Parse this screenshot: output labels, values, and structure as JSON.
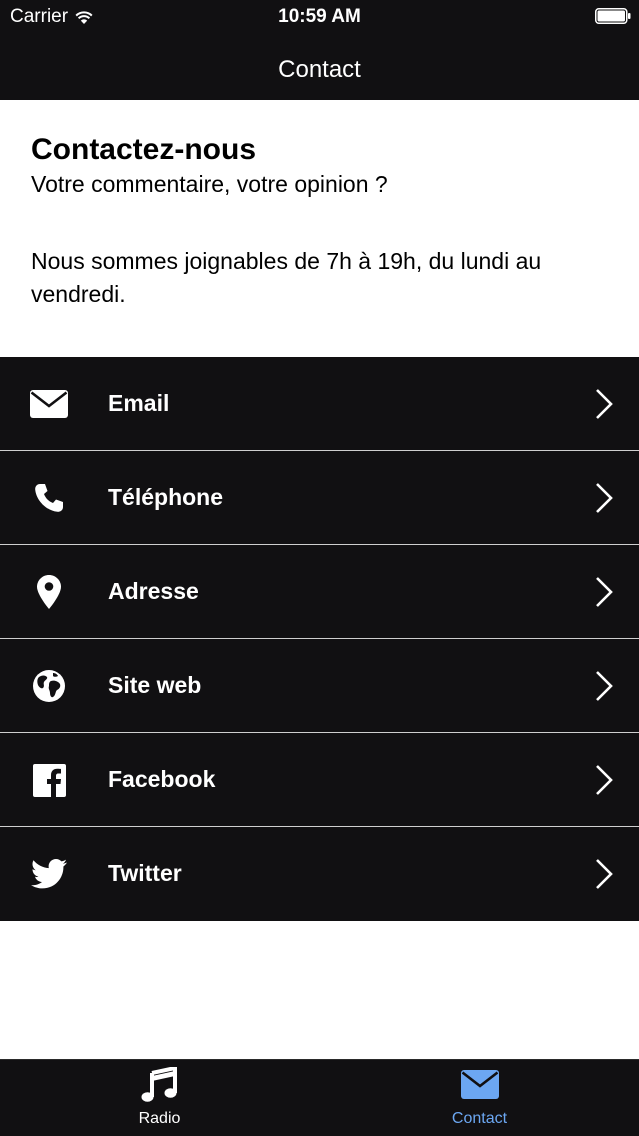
{
  "status_bar": {
    "carrier": "Carrier",
    "time": "10:59 AM"
  },
  "nav": {
    "title": "Contact"
  },
  "intro": {
    "heading": "Contactez-nous",
    "subheading": "Votre commentaire, votre opinion ?",
    "hours": "Nous sommes joignables de 7h à 19h, du lundi au vendredi."
  },
  "contact_items": [
    {
      "label": "Email",
      "icon": "envelope-icon"
    },
    {
      "label": "Téléphone",
      "icon": "phone-icon"
    },
    {
      "label": "Adresse",
      "icon": "map-pin-icon"
    },
    {
      "label": "Site web",
      "icon": "globe-icon"
    },
    {
      "label": "Facebook",
      "icon": "facebook-icon"
    },
    {
      "label": "Twitter",
      "icon": "twitter-icon"
    }
  ],
  "tab_bar": {
    "tabs": [
      {
        "label": "Radio",
        "icon": "music-note-icon",
        "selected": false
      },
      {
        "label": "Contact",
        "icon": "envelope-icon",
        "selected": true
      }
    ]
  },
  "colors": {
    "bar_background": "#111012",
    "selected_tab": "#6ca7f2",
    "text_on_dark": "#ffffff",
    "separator": "#cfcfcf"
  }
}
